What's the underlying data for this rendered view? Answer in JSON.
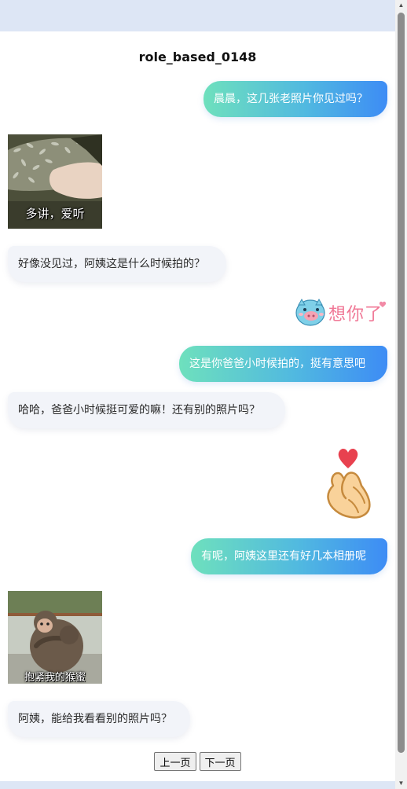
{
  "page": {
    "title": "role_based_0148"
  },
  "messages": {
    "m1": {
      "side": "right",
      "text": "晨晨，这几张老照片你见过吗？"
    },
    "m2": {
      "type": "sticker",
      "caption": "多讲，爱听"
    },
    "m3": {
      "side": "left",
      "text": "好像没见过，阿姨这是什么时候拍的？"
    },
    "m4": {
      "type": "sticker",
      "caption": "想你了"
    },
    "m5": {
      "side": "right",
      "text": "这是你爸爸小时候拍的，挺有意思吧"
    },
    "m6": {
      "side": "left",
      "text": "哈哈，爸爸小时候挺可爱的嘛！还有别的照片吗？"
    },
    "m7": {
      "type": "sticker",
      "icon": "finger-heart-icon"
    },
    "m8": {
      "side": "right",
      "text": "有呢，阿姨这里还有好几本相册呢"
    },
    "m9": {
      "type": "sticker",
      "caption": "抱紧我的猴蜜"
    },
    "m10": {
      "side": "left",
      "text": "阿姨，能给我看看别的照片吗？"
    }
  },
  "pager": {
    "prev_label": "上一页",
    "next_label": "下一页"
  },
  "colors": {
    "bubble_right_start": "#6ee0bd",
    "bubble_right_end": "#3d8cf5",
    "bubble_left": "#f2f4f9",
    "page_background": "#dde6f5"
  }
}
